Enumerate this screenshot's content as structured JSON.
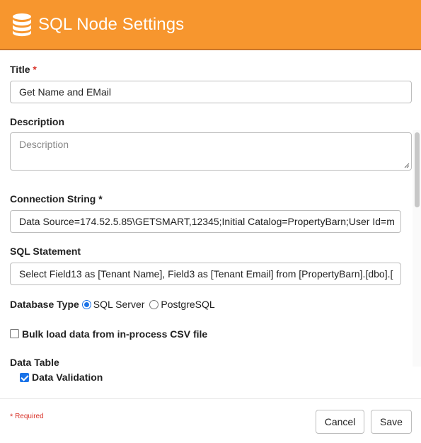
{
  "header": {
    "title": "SQL Node Settings",
    "icon": "database-icon",
    "background": "#f7962e"
  },
  "form": {
    "title_label": "Title",
    "required_mark": "*",
    "title_value": "Get Name and EMail",
    "description_label": "Description",
    "description_placeholder": "Description",
    "connection_label": "Connection String",
    "connection_value": "Data Source=174.52.5.85\\GETSMART,12345;Initial Catalog=PropertyBarn;User Id=m",
    "sql_label": "SQL Statement",
    "sql_value": "Select Field13 as [Tenant Name], Field3 as [Tenant Email] from [PropertyBarn].[dbo].[",
    "db_type_label": "Database Type",
    "db_options": [
      "SQL Server",
      "PostgreSQL"
    ],
    "db_selected": "SQL Server",
    "bulk_load_label": "Bulk load data from in-process CSV file",
    "bulk_load_checked": false,
    "data_table_label": "Data Table",
    "data_validation_label": "Data Validation",
    "data_validation_checked": true
  },
  "footer": {
    "required_note": "Required",
    "cancel_label": "Cancel",
    "save_label": "Save"
  }
}
